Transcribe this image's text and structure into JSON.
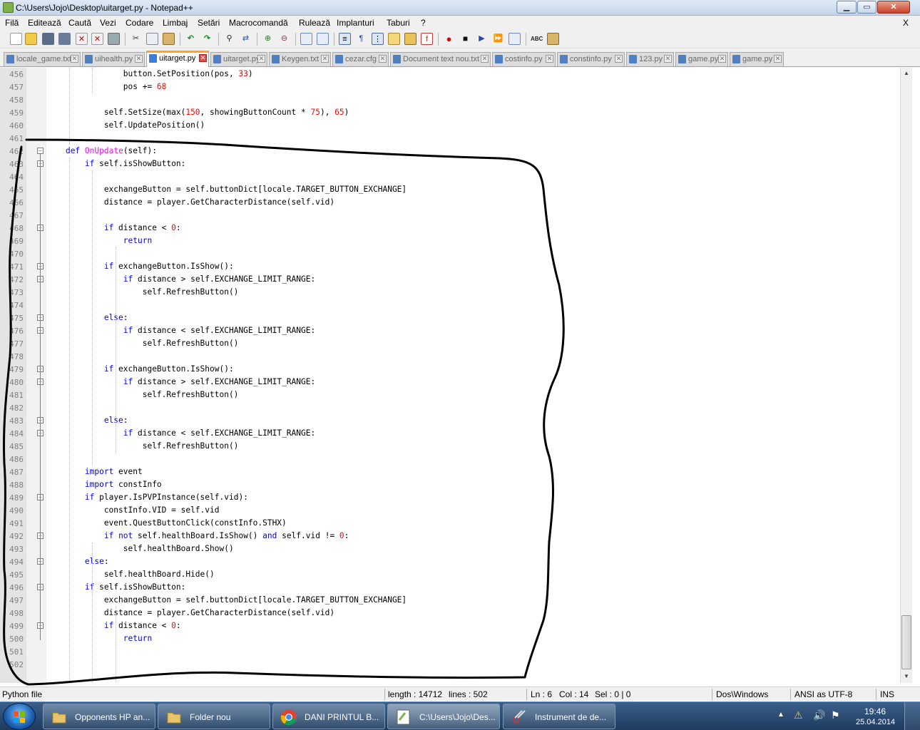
{
  "window": {
    "title": "C:\\Users\\Jojo\\Desktop\\uitarget.py - Notepad++",
    "min": "▁",
    "max": "▭",
    "close": "✕"
  },
  "menu": {
    "items": [
      "Filă",
      "Editează",
      "Caută",
      "Vezi",
      "Codare",
      "Limbaj",
      "Setări",
      "Macrocomandă",
      "Rulează",
      "Implanturi",
      "Taburi",
      "?"
    ],
    "close_doc": "X"
  },
  "toolbar_icons": [
    "new-icon",
    "open-icon",
    "save-icon",
    "save-all-icon",
    "close-icon",
    "close-all-icon",
    "print-icon",
    "cut-icon",
    "copy-icon",
    "paste-icon",
    "undo-icon",
    "redo-icon",
    "find-icon",
    "replace-icon",
    "zoom-in-icon",
    "zoom-out-icon",
    "sync-v-icon",
    "sync-h-icon",
    "word-wrap-icon",
    "all-chars-icon",
    "indent-guide-icon",
    "udl-icon",
    "doc-map-icon",
    "function-list-icon",
    "record-icon",
    "stop-icon",
    "play-icon",
    "play-multi-icon",
    "save-macro-icon",
    "spellcheck-icon",
    "plugin-icon"
  ],
  "tabs": [
    {
      "label": "locale_game.txt",
      "active": false
    },
    {
      "label": "uihealth.py",
      "active": false
    },
    {
      "label": "uitarget.py",
      "active": true
    },
    {
      "label": "uitarget.py",
      "active": false
    },
    {
      "label": "Keygen.txt",
      "active": false
    },
    {
      "label": "cezar.cfg",
      "active": false
    },
    {
      "label": "Document text nou.txt",
      "active": false
    },
    {
      "label": "costinfo.py",
      "active": false
    },
    {
      "label": "constinfo.py",
      "active": false
    },
    {
      "label": "123.py",
      "active": false
    },
    {
      "label": "game.py",
      "active": false
    },
    {
      "label": "game.py",
      "active": false
    }
  ],
  "editor": {
    "lines": [
      {
        "n": "456",
        "code": [
          [
            "",
            "                button.SetPosition(pos, "
          ],
          [
            "nm",
            "33"
          ],
          [
            "",
            ")"
          ]
        ]
      },
      {
        "n": "457",
        "code": [
          [
            "",
            "                pos += "
          ],
          [
            "nm",
            "68"
          ]
        ]
      },
      {
        "n": "458",
        "code": []
      },
      {
        "n": "459",
        "code": [
          [
            "",
            "            self.SetSize(max("
          ],
          [
            "nm",
            "150"
          ],
          [
            "",
            ", showingButtonCount * "
          ],
          [
            "nm",
            "75"
          ],
          [
            "",
            "), "
          ],
          [
            "nm",
            "65"
          ],
          [
            "",
            ")"
          ]
        ]
      },
      {
        "n": "460",
        "code": [
          [
            "",
            "            self.UpdatePosition()"
          ]
        ]
      },
      {
        "n": "461",
        "code": []
      },
      {
        "n": "462",
        "code": [
          [
            "",
            "    "
          ],
          [
            "kw",
            "def"
          ],
          [
            "",
            " "
          ],
          [
            "fn",
            "OnUpdate"
          ],
          [
            "",
            "(self):"
          ]
        ],
        "fold": "-"
      },
      {
        "n": "463",
        "code": [
          [
            "",
            "        "
          ],
          [
            "kw",
            "if"
          ],
          [
            "",
            " self.isShowButton:"
          ]
        ],
        "fold": "-"
      },
      {
        "n": "464",
        "code": []
      },
      {
        "n": "465",
        "code": [
          [
            "",
            "            exchangeButton = self.buttonDict[locale.TARGET_BUTTON_EXCHANGE]"
          ]
        ]
      },
      {
        "n": "466",
        "code": [
          [
            "",
            "            distance = player.GetCharacterDistance(self.vid)"
          ]
        ]
      },
      {
        "n": "467",
        "code": []
      },
      {
        "n": "468",
        "code": [
          [
            "",
            "            "
          ],
          [
            "kw",
            "if"
          ],
          [
            "",
            " distance < "
          ],
          [
            "nm",
            "0"
          ],
          [
            "",
            ":"
          ]
        ],
        "fold": "-"
      },
      {
        "n": "469",
        "code": [
          [
            "",
            "                "
          ],
          [
            "kw",
            "return"
          ]
        ]
      },
      {
        "n": "470",
        "code": []
      },
      {
        "n": "471",
        "code": [
          [
            "",
            "            "
          ],
          [
            "kw",
            "if"
          ],
          [
            "",
            " exchangeButton.IsShow():"
          ]
        ],
        "fold": "-"
      },
      {
        "n": "472",
        "code": [
          [
            "",
            "                "
          ],
          [
            "kw",
            "if"
          ],
          [
            "",
            " distance > self.EXCHANGE_LIMIT_RANGE:"
          ]
        ],
        "fold": "-"
      },
      {
        "n": "473",
        "code": [
          [
            "",
            "                    self.RefreshButton()"
          ]
        ]
      },
      {
        "n": "474",
        "code": []
      },
      {
        "n": "475",
        "code": [
          [
            "",
            "            "
          ],
          [
            "kw",
            "else"
          ],
          [
            "",
            ":"
          ]
        ],
        "fold": "-"
      },
      {
        "n": "476",
        "code": [
          [
            "",
            "                "
          ],
          [
            "kw",
            "if"
          ],
          [
            "",
            " distance < self.EXCHANGE_LIMIT_RANGE:"
          ]
        ],
        "fold": "-"
      },
      {
        "n": "477",
        "code": [
          [
            "",
            "                    self.RefreshButton()"
          ]
        ]
      },
      {
        "n": "478",
        "code": []
      },
      {
        "n": "479",
        "code": [
          [
            "",
            "            "
          ],
          [
            "kw",
            "if"
          ],
          [
            "",
            " exchangeButton.IsShow():"
          ]
        ],
        "fold": "-"
      },
      {
        "n": "480",
        "code": [
          [
            "",
            "                "
          ],
          [
            "kw",
            "if"
          ],
          [
            "",
            " distance > self.EXCHANGE_LIMIT_RANGE:"
          ]
        ],
        "fold": "-"
      },
      {
        "n": "481",
        "code": [
          [
            "",
            "                    self.RefreshButton()"
          ]
        ]
      },
      {
        "n": "482",
        "code": []
      },
      {
        "n": "483",
        "code": [
          [
            "",
            "            "
          ],
          [
            "kw",
            "else"
          ],
          [
            "",
            ":"
          ]
        ],
        "fold": "-"
      },
      {
        "n": "484",
        "code": [
          [
            "",
            "                "
          ],
          [
            "kw",
            "if"
          ],
          [
            "",
            " distance < self.EXCHANGE_LIMIT_RANGE:"
          ]
        ],
        "fold": "-"
      },
      {
        "n": "485",
        "code": [
          [
            "",
            "                    self.RefreshButton()"
          ]
        ]
      },
      {
        "n": "486",
        "code": []
      },
      {
        "n": "487",
        "code": [
          [
            "",
            "        "
          ],
          [
            "kw",
            "import"
          ],
          [
            "",
            " event"
          ]
        ]
      },
      {
        "n": "488",
        "code": [
          [
            "",
            "        "
          ],
          [
            "kw",
            "import"
          ],
          [
            "",
            " constInfo"
          ]
        ]
      },
      {
        "n": "489",
        "code": [
          [
            "",
            "        "
          ],
          [
            "kw",
            "if"
          ],
          [
            "",
            " player.IsPVPInstance(self.vid):"
          ]
        ],
        "fold": "-"
      },
      {
        "n": "490",
        "code": [
          [
            "",
            "            constInfo.VID = self.vid"
          ]
        ]
      },
      {
        "n": "491",
        "code": [
          [
            "",
            "            event.QuestButtonClick(constInfo.STHX)"
          ]
        ]
      },
      {
        "n": "492",
        "code": [
          [
            "",
            "            "
          ],
          [
            "kw",
            "if"
          ],
          [
            "",
            " "
          ],
          [
            "kw",
            "not"
          ],
          [
            "",
            " self.healthBoard.IsShow() "
          ],
          [
            "kw",
            "and"
          ],
          [
            "",
            " self.vid != "
          ],
          [
            "nm",
            "0"
          ],
          [
            "",
            ":"
          ]
        ],
        "fold": "-"
      },
      {
        "n": "493",
        "code": [
          [
            "",
            "                self.healthBoard.Show()"
          ]
        ]
      },
      {
        "n": "494",
        "code": [
          [
            "",
            "        "
          ],
          [
            "kw",
            "else"
          ],
          [
            "",
            ":"
          ]
        ],
        "fold": "-"
      },
      {
        "n": "495",
        "code": [
          [
            "",
            "            self.healthBoard.Hide()"
          ]
        ]
      },
      {
        "n": "496",
        "code": [
          [
            "",
            "        "
          ],
          [
            "kw",
            "if"
          ],
          [
            "",
            " self.isShowButton:"
          ]
        ],
        "fold": "-"
      },
      {
        "n": "497",
        "code": [
          [
            "",
            "            exchangeButton = self.buttonDict[locale.TARGET_BUTTON_EXCHANGE]"
          ]
        ]
      },
      {
        "n": "498",
        "code": [
          [
            "",
            "            distance = player.GetCharacterDistance(self.vid)"
          ]
        ]
      },
      {
        "n": "499",
        "code": [
          [
            "",
            "            "
          ],
          [
            "kw",
            "if"
          ],
          [
            "",
            " distance < "
          ],
          [
            "nm",
            "0"
          ],
          [
            "",
            ":"
          ]
        ],
        "fold": "-"
      },
      {
        "n": "500",
        "code": [
          [
            "",
            "                "
          ],
          [
            "kw",
            "return"
          ]
        ]
      },
      {
        "n": "501",
        "code": []
      },
      {
        "n": "502",
        "code": []
      }
    ]
  },
  "status": {
    "file_type": "Python file",
    "length": "length : 14712",
    "lines": "lines : 502",
    "ln": "Ln : 6",
    "col": "Col : 14",
    "sel": "Sel : 0 | 0",
    "eol": "Dos\\Windows",
    "encoding": "ANSI as UTF-8",
    "mode": "INS"
  },
  "taskbar": {
    "tasks": [
      {
        "label": "Opponents HP an...",
        "icon": "folder-icon"
      },
      {
        "label": "Folder nou",
        "icon": "folder-icon"
      },
      {
        "label": "DANI PRINTUL B...",
        "icon": "chrome-icon"
      },
      {
        "label": "C:\\Users\\Jojo\\Des...",
        "icon": "notepadpp-icon"
      },
      {
        "label": "Instrument de de...",
        "icon": "snipping-tool-icon"
      }
    ],
    "time": "19:46",
    "date": "25.04.2014"
  },
  "colors": {
    "keyword": "#0000ff",
    "function_name": "#ff00ff",
    "number": "#ff0000",
    "active_tab_accent": "#f7a43a"
  }
}
